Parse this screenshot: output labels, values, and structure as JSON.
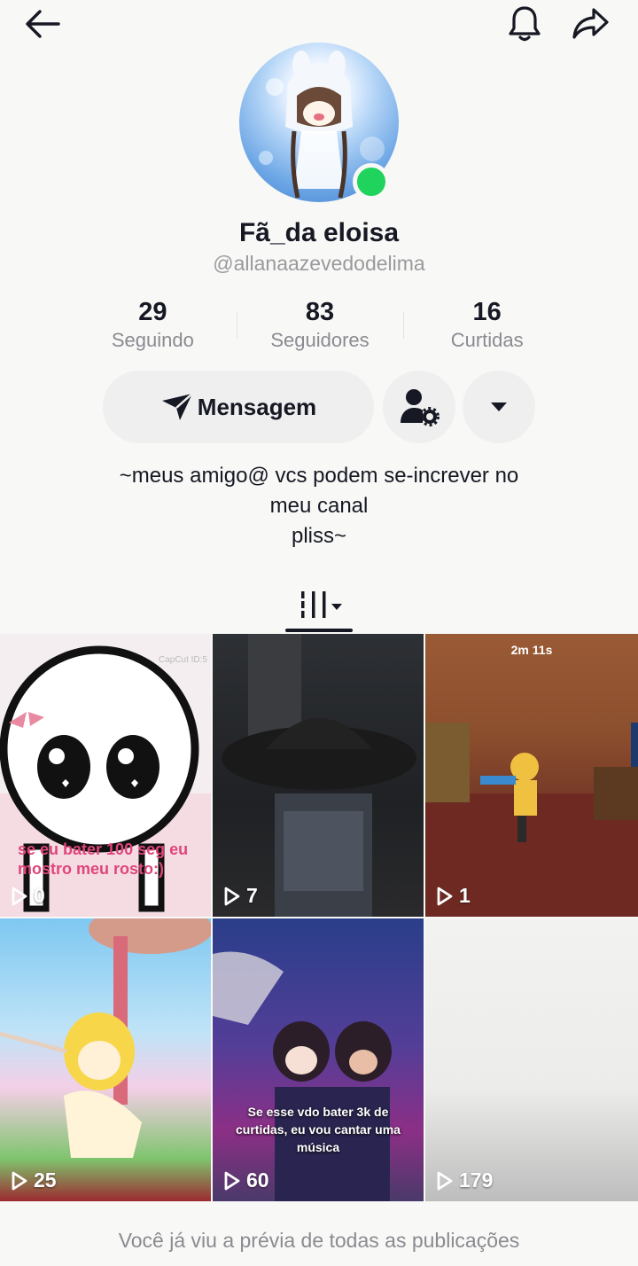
{
  "profile": {
    "display_name": "Fã_da eloisa",
    "handle": "@allanaazevedodelima",
    "online_color": "#1fd35c"
  },
  "stats": [
    {
      "value": "29",
      "label": "Seguindo"
    },
    {
      "value": "83",
      "label": "Seguidores"
    },
    {
      "value": "16",
      "label": "Curtidas"
    }
  ],
  "actions": {
    "message_label": "Mensagem"
  },
  "bio": {
    "lines": [
      "~meus amigo@ vcs podem se-increver no",
      "meu canal",
      "pliss~"
    ]
  },
  "videos": [
    {
      "views": "0",
      "overlay": "se eu bater 100 seg eu mostro meu rosto:)",
      "watermark": "CapCut ID:5"
    },
    {
      "views": "7"
    },
    {
      "views": "1",
      "timer": "2m 11s"
    },
    {
      "views": "25"
    },
    {
      "views": "60",
      "overlay": "Se esse vdo bater 3k de curtidas, eu vou cantar uma música"
    },
    {
      "views": "179"
    }
  ],
  "footer": {
    "text": "Você já viu a prévia de todas as publicações"
  },
  "icons": {
    "back": "arrow-left-icon",
    "notifications": "bell-icon",
    "share": "share-arrow-icon",
    "message": "paper-plane-icon",
    "add_friend": "user-settings-icon",
    "more": "caret-down-icon",
    "grid_tab": "grid-bars-icon",
    "play": "play-outline-icon"
  }
}
